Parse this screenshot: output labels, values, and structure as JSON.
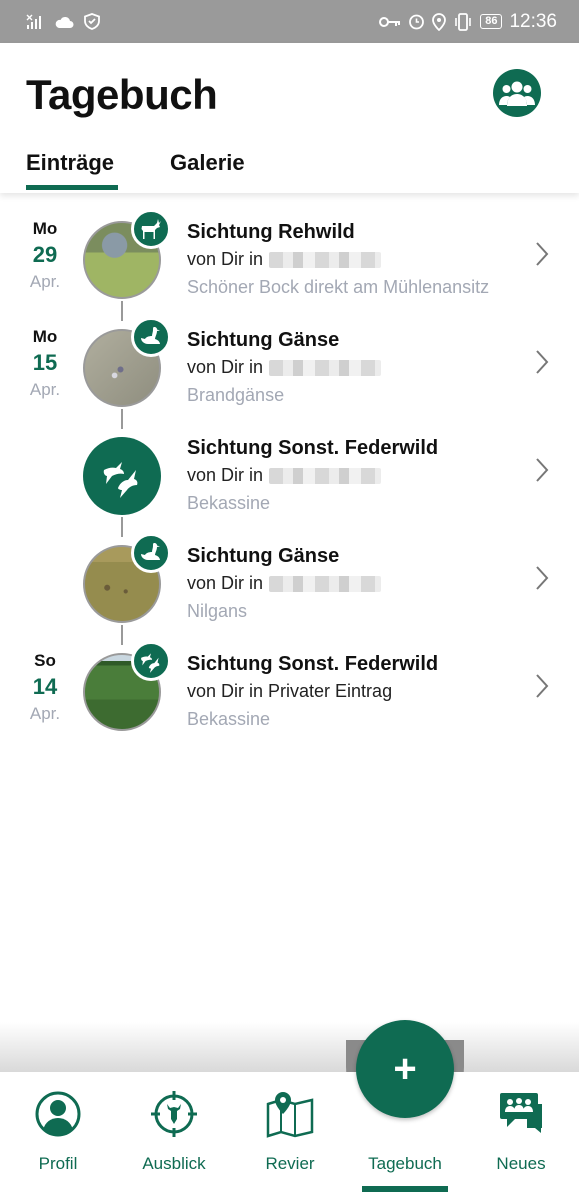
{
  "status_bar": {
    "time": "12:36",
    "battery": "86"
  },
  "header": {
    "title": "Tagebuch",
    "tabs": [
      {
        "label": "Einträge",
        "active": true
      },
      {
        "label": "Galerie",
        "active": false
      }
    ]
  },
  "entries": [
    {
      "weekday": "Mo",
      "day": "29",
      "month": "Apr.",
      "title": "Sichtung Rehwild",
      "subtitle": "von Dir in",
      "note": "Schöner Bock direkt am Mühlenansitz",
      "badge_icon": "deer-icon",
      "photo_colors": [
        "#9ca88a",
        "#7f9a55",
        "#a7b56d"
      ]
    },
    {
      "weekday": "Mo",
      "day": "15",
      "month": "Apr.",
      "title": "Sichtung Gänse",
      "subtitle": "von Dir in",
      "note": "Brandgänse",
      "badge_icon": "goose-icon",
      "photo_colors": [
        "#a8a696",
        "#8f8e7f",
        "#b4b2a2"
      ]
    },
    {
      "weekday": "",
      "day": "",
      "month": "",
      "title": "Sichtung Sonst. Federwild",
      "subtitle": "von Dir in",
      "note": "Bekassine",
      "badge_icon": "birds-icon",
      "photo_colors": []
    },
    {
      "weekday": "",
      "day": "",
      "month": "",
      "title": "Sichtung Gänse",
      "subtitle": "von Dir in",
      "note": "Nilgans",
      "badge_icon": "goose-icon",
      "photo_colors": [
        "#9c9256",
        "#8a8046",
        "#b0a56a"
      ]
    },
    {
      "weekday": "So",
      "day": "14",
      "month": "Apr.",
      "title": "Sichtung Sonst. Federwild",
      "subtitle": "von Dir in Privater Eintrag",
      "note": "Bekassine",
      "badge_icon": "birds-icon",
      "photo_colors": [
        "#3f6f35",
        "#5a8a45",
        "#2f5a28"
      ]
    }
  ],
  "bottom_nav": {
    "items": [
      {
        "label": "Profil",
        "icon": "profile-icon"
      },
      {
        "label": "Ausblick",
        "icon": "crosshair-deer-icon"
      },
      {
        "label": "Revier",
        "icon": "map-pin-icon"
      },
      {
        "label": "Tagebuch",
        "icon": "diary-icon",
        "active": true
      },
      {
        "label": "Neues",
        "icon": "news-chat-icon"
      }
    ],
    "fab_label": "+"
  },
  "colors": {
    "accent": "#0f6b52",
    "muted_text": "#a3a8b4",
    "status_bar": "#9a9a9a"
  }
}
